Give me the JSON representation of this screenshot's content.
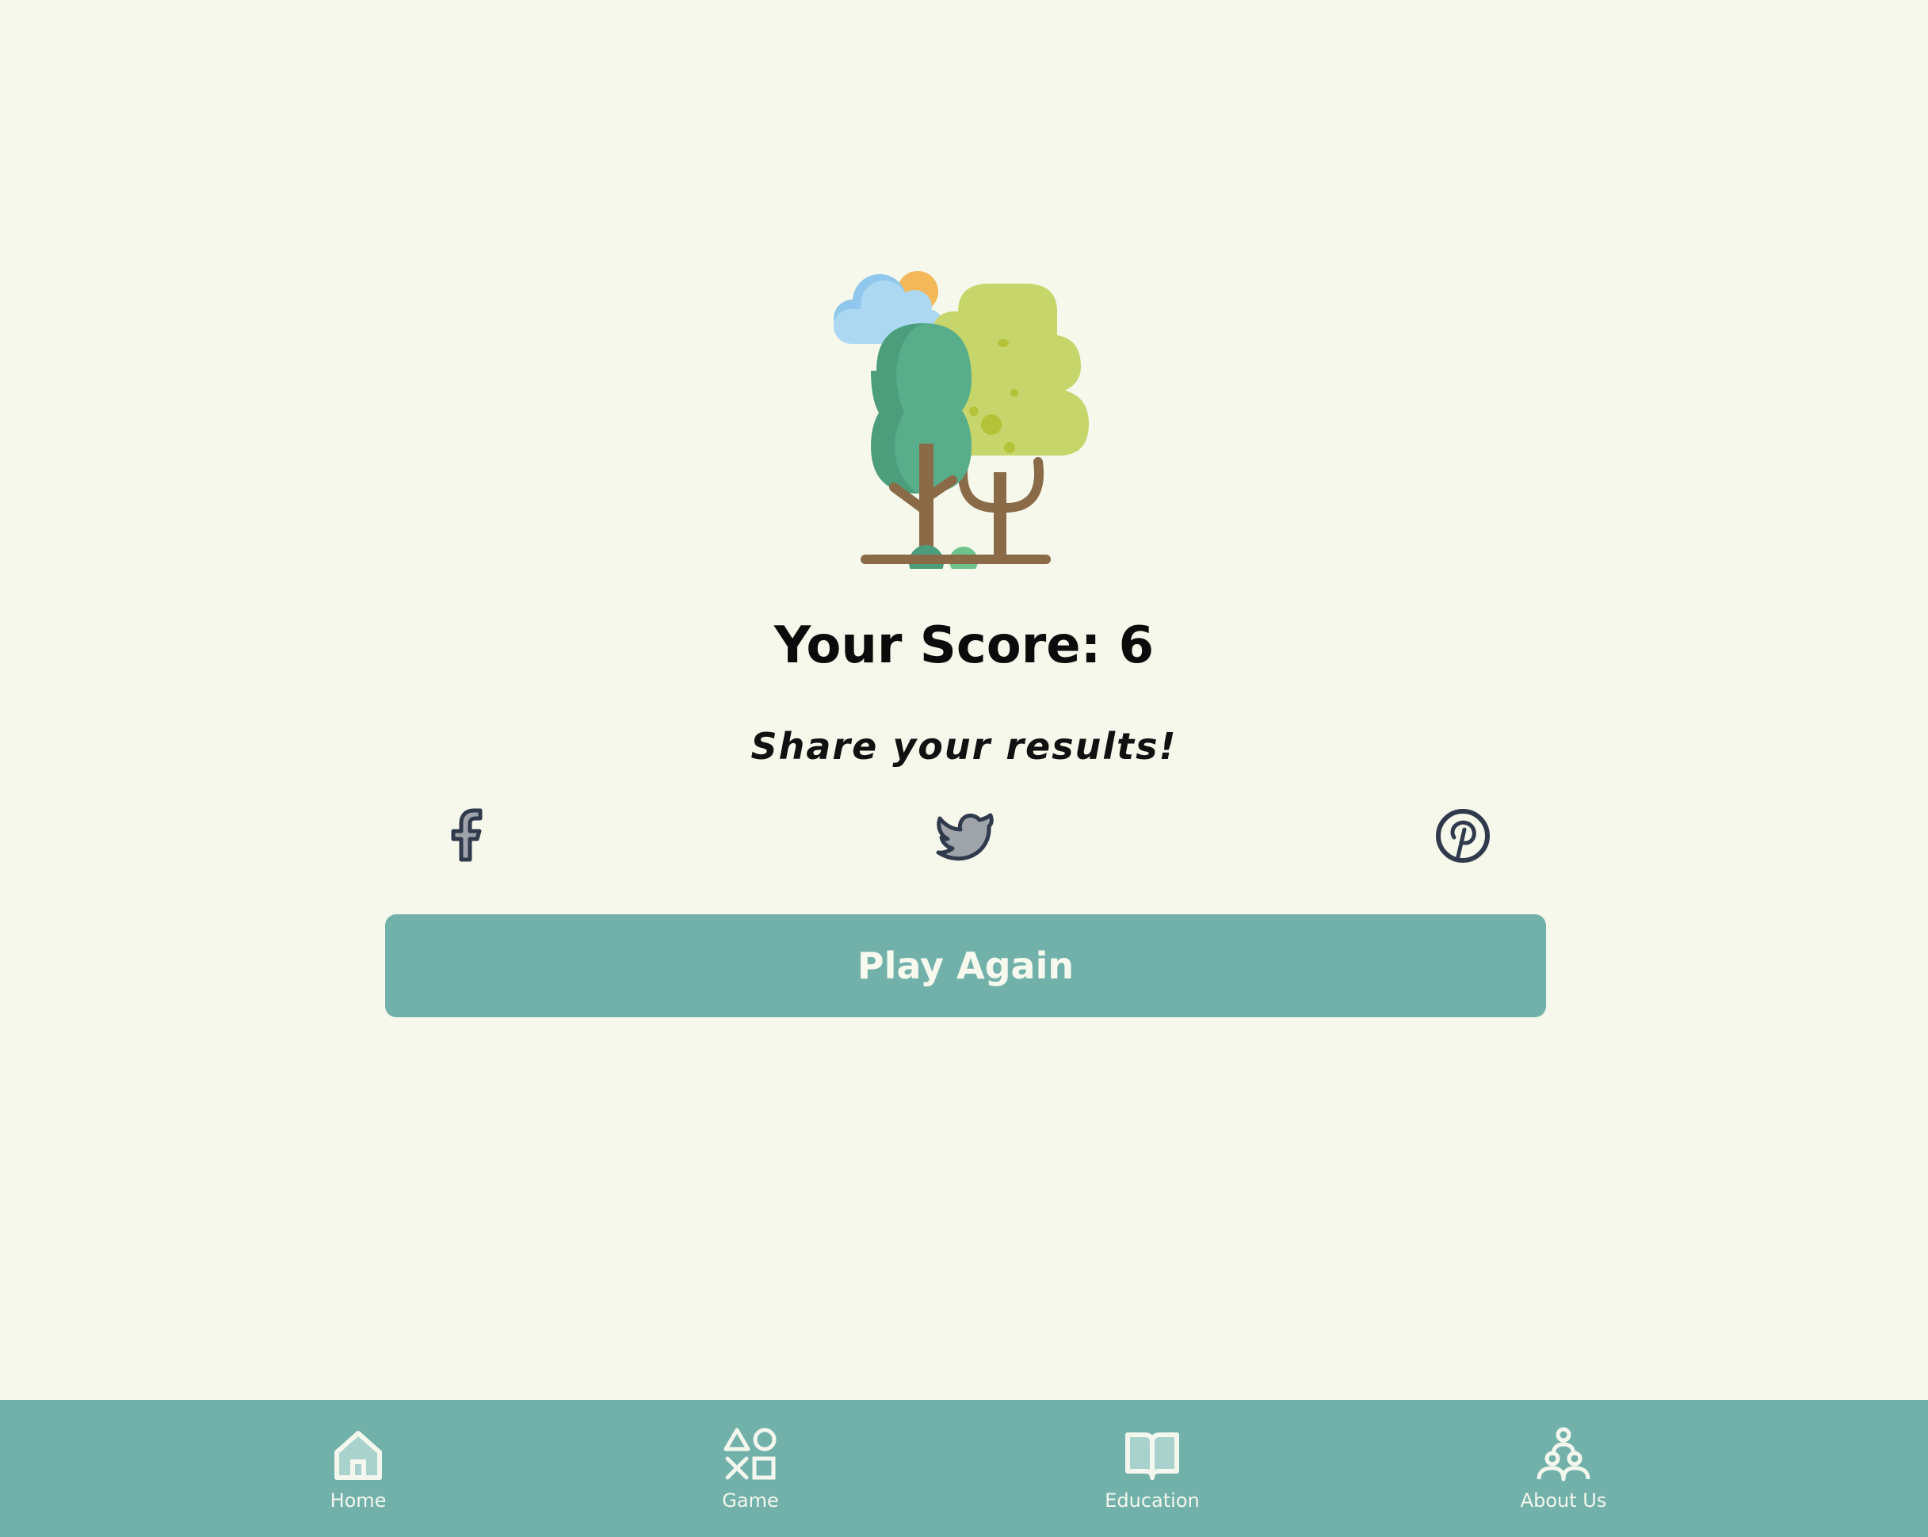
{
  "score": {
    "label": "Your Score: 6"
  },
  "share": {
    "text": "Share your results!",
    "icons": [
      "facebook-icon",
      "twitter-icon",
      "pinterest-icon"
    ]
  },
  "actions": {
    "play_again_label": "Play Again"
  },
  "nav": {
    "items": [
      {
        "label": "Home",
        "icon": "home-icon"
      },
      {
        "label": "Game",
        "icon": "game-icon"
      },
      {
        "label": "Education",
        "icon": "book-icon"
      },
      {
        "label": "About Us",
        "icon": "people-icon"
      }
    ]
  },
  "colors": {
    "background": "#f6f8eb",
    "accent": "#72b1aa",
    "icon_dark": "#2f3a4c"
  }
}
